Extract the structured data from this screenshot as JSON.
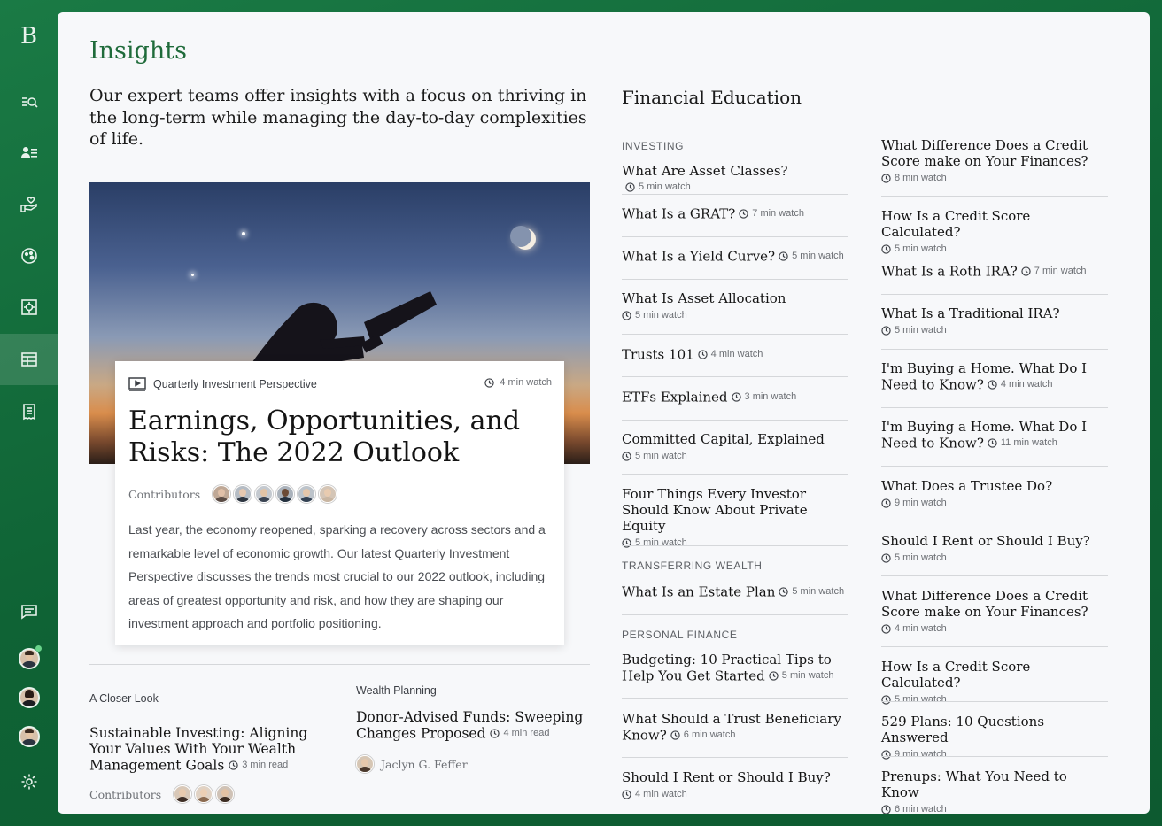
{
  "app": {
    "logo": "B"
  },
  "sidebar": {
    "items": [
      {
        "icon": "search-list-icon"
      },
      {
        "icon": "people-list-icon"
      },
      {
        "icon": "hand-heart-icon"
      },
      {
        "icon": "palette-icon"
      },
      {
        "icon": "vault-icon"
      },
      {
        "icon": "calendar-grid-icon",
        "active": true
      },
      {
        "icon": "document-icon"
      }
    ],
    "bottom": [
      {
        "icon": "chat-icon"
      },
      {
        "icon": "settings-icon"
      }
    ]
  },
  "page": {
    "title": "Insights",
    "intro": "Our expert teams offer insights with a focus on thriving in the long-term while managing the day-to-day complexities of life."
  },
  "feature": {
    "type_label": "Quarterly Investment Perspective",
    "duration": "4 min watch",
    "title": "Earnings, Opportunities, and Risks: The 2022 Outlook",
    "contributors_label": "Contributors",
    "body": "Last year, the economy reopened, sparking a recovery across sectors and a remarkable level of economic growth. Our latest Quarterly Investment Perspective discusses the trends most crucial to our 2022 outlook, including areas of greatest opportunity and risk, and how they are shaping our investment approach and portfolio positioning."
  },
  "stories": [
    {
      "category": "A Closer Look",
      "title": "Sustainable Investing: Aligning Your Values With Your Wealth Management Goals",
      "meta": "3 min read",
      "contributors_label": "Contributors"
    },
    {
      "category": "Wealth Planning",
      "title": "Donor-Advised Funds: Sweeping Changes Proposed",
      "meta": "4 min read",
      "author": "Jaclyn G. Feffer"
    }
  ],
  "education": {
    "title": "Financial Education",
    "categories": {
      "investing": "INVESTING",
      "transferring": "TRANSFERRING WEALTH",
      "personal": "PERSONAL FINANCE"
    },
    "left": [
      {
        "title": "What Are Asset Classes?",
        "meta": "5 min watch"
      },
      {
        "title": "What Is a GRAT?",
        "meta": "7 min watch"
      },
      {
        "title": "What Is a Yield Curve?",
        "meta": "5 min watch"
      },
      {
        "title": "What Is Asset Allocation",
        "meta": "5 min watch"
      },
      {
        "title": "Trusts 101",
        "meta": "4 min watch"
      },
      {
        "title": "ETFs Explained",
        "meta": "3 min watch"
      },
      {
        "title": "Committed Capital, Explained",
        "meta": "5 min watch"
      },
      {
        "title": "Four Things Every Investor Should Know About Private Equity",
        "meta": "5 min watch"
      },
      {
        "title": "What Is an Estate Plan",
        "meta": "5 min watch"
      },
      {
        "title": "Budgeting: 10 Practical Tips to Help You Get Started",
        "meta": "5 min watch"
      },
      {
        "title": "What Should a Trust Beneficiary Know?",
        "meta": "6 min watch"
      },
      {
        "title": "Should I Rent or Should I Buy?",
        "meta": "4 min watch"
      }
    ],
    "right": [
      {
        "title": "What Difference Does a Credit Score make on Your Finances?",
        "meta": "8 min watch"
      },
      {
        "title": "How Is a Credit Score Calculated?",
        "meta": "5 min watch"
      },
      {
        "title": "What Is a Roth IRA?",
        "meta": "7 min watch"
      },
      {
        "title": "What Is a Traditional IRA?",
        "meta": "5 min watch"
      },
      {
        "title": "I'm Buying a Home. What Do I Need to Know?",
        "meta": "4 min watch"
      },
      {
        "title": "I'm Buying a Home. What Do I Need to Know?",
        "meta": "11 min watch"
      },
      {
        "title": "What Does a Trustee Do?",
        "meta": "9 min watch"
      },
      {
        "title": "Should I Rent or Should I Buy?",
        "meta": "5 min watch"
      },
      {
        "title": "What Difference Does a Credit Score make on Your Finances?",
        "meta": "4 min watch"
      },
      {
        "title": "How Is a Credit Score Calculated?",
        "meta": "5 min watch"
      },
      {
        "title": "529 Plans: 10 Questions Answered",
        "meta": "9 min watch"
      },
      {
        "title": "Prenups: What You Need to Know",
        "meta": "6 min watch"
      }
    ]
  }
}
